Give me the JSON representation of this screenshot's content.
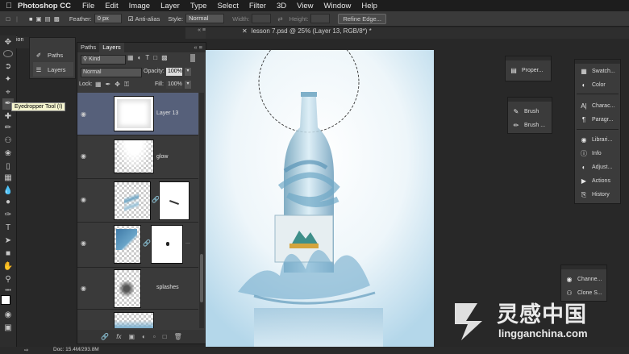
{
  "menubar": {
    "app_name": "Photoshop CC",
    "items": [
      "File",
      "Edit",
      "Image",
      "Layer",
      "Type",
      "Select",
      "Filter",
      "3D",
      "View",
      "Window",
      "Help"
    ]
  },
  "options_bar": {
    "feather_label": "Feather:",
    "feather_value": "0 px",
    "antialias_label": "Anti-alias",
    "style_label": "Style:",
    "style_value": "Normal",
    "width_label": "Width:",
    "height_label": "Height:",
    "refine_edge": "Refine Edge..."
  },
  "document_tab": {
    "title": "lesson 7.psd @ 25% (Layer 13, RGB/8*) *"
  },
  "tooltip": "Eyedropper Tool (I)",
  "mini_panel": {
    "items": [
      {
        "label": "Paths",
        "icon": "paths-icon"
      },
      {
        "label": "Layers",
        "icon": "layers-icon"
      }
    ],
    "header": "ion"
  },
  "layers_panel": {
    "tabs": [
      "Paths",
      "Layers"
    ],
    "active_tab": "Layers",
    "filter_kind": "Kind",
    "blend_mode": "Normal",
    "opacity_label": "Opacity:",
    "opacity_value": "100%",
    "lock_label": "Lock:",
    "fill_label": "Fill:",
    "fill_value": "100%",
    "layers": [
      {
        "name": "Layer 13",
        "selected": true
      },
      {
        "name": "glow",
        "selected": false
      },
      {
        "name": "",
        "selected": false
      },
      {
        "name": "",
        "selected": false
      },
      {
        "name": "splashes",
        "selected": false
      },
      {
        "name": "",
        "selected": false
      }
    ],
    "footer_icons": [
      "link-icon",
      "fx-icon",
      "mask-icon",
      "adjustment-icon",
      "group-icon",
      "new-layer-icon",
      "trash-icon"
    ]
  },
  "right_panels": {
    "properties": {
      "label": "Proper..."
    },
    "brush_group": [
      {
        "label": "Brush"
      },
      {
        "label": "Brush ..."
      }
    ],
    "dock": [
      {
        "label": "Swatch...",
        "icon": "swatches-icon"
      },
      {
        "label": "Color",
        "icon": "color-icon"
      },
      {
        "label": "Charac...",
        "icon": "character-icon"
      },
      {
        "label": "Paragr...",
        "icon": "paragraph-icon"
      },
      {
        "label": "Librari...",
        "icon": "libraries-icon"
      },
      {
        "label": "Info",
        "icon": "info-icon"
      },
      {
        "label": "Adjust...",
        "icon": "adjustments-icon"
      },
      {
        "label": "Actions",
        "icon": "actions-icon"
      },
      {
        "label": "History",
        "icon": "history-icon"
      }
    ],
    "channels_group": [
      {
        "label": "Channe..."
      },
      {
        "label": "Clone S..."
      }
    ]
  },
  "status_bar": {
    "doc": "Doc: 15.4M/293.8M"
  },
  "watermark": {
    "cn": "灵感中国",
    "url": "lingganchina.com"
  },
  "colors": {
    "bg": "#282828",
    "panel": "#3a3a3a",
    "selected_layer": "#56607a"
  }
}
